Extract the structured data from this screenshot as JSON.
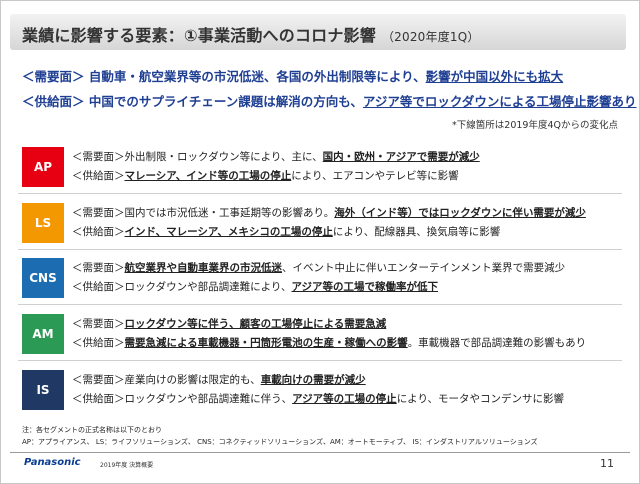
{
  "title": {
    "main": "業績に影響する要素：①事業活動へのコロナ影響",
    "sub": "（2020年度1Q）"
  },
  "summary": {
    "demand": {
      "label": "＜需要面＞",
      "text": "自動車・航空業界等の市況低迷、各国の外出制限等により、",
      "emph": "影響が中国以外にも拡大"
    },
    "supply": {
      "label": "＜供給面＞",
      "text": "中国でのサプライチェーン課題は解消の方向も、",
      "emph": "アジア等でロックダウンによる工場停止影響あり"
    }
  },
  "note_change": "*下線箇所は2019年度4Qからの変化点",
  "segments": [
    {
      "code": "AP",
      "color": "#e60012",
      "demand_prefix": "＜需要面＞外出制限・ロックダウン等により、主に、",
      "demand_emph": "国内・欧州・アジアで需要が減少",
      "demand_suffix": "",
      "supply_prefix": "＜供給面＞",
      "supply_emph": "マレーシア、インド等の工場の停止",
      "supply_suffix": "により、エアコンやテレビ等に影響"
    },
    {
      "code": "LS",
      "color": "#f39800",
      "demand_prefix": "＜需要面＞国内では市況低迷・工事延期等の影響あり。",
      "demand_emph": "海外（インド等）ではロックダウンに伴い需要が減少",
      "demand_suffix": "",
      "supply_prefix": "＜供給面＞",
      "supply_emph": "インド、マレーシア、メキシコの工場の停止",
      "supply_suffix": "により、配線器具、換気扇等に影響"
    },
    {
      "code": "CNS",
      "color": "#1b6cb0",
      "demand_prefix": "＜需要面＞",
      "demand_emph": "航空業界や自動車業界の市況低迷",
      "demand_suffix": "、イベント中止に伴いエンターテインメント業界で需要減少",
      "supply_prefix": "＜供給面＞ロックダウンや部品調達難により、",
      "supply_emph": "アジア等の工場で稼働率が低下",
      "supply_suffix": ""
    },
    {
      "code": "AM",
      "color": "#2b9a55",
      "demand_prefix": "＜需要面＞",
      "demand_emph": "ロックダウン等に伴う、顧客の工場停止による需要急減",
      "demand_suffix": "",
      "supply_prefix": "＜供給面＞",
      "supply_emph": "需要急減による車載機器・円筒形電池の生産・稼働への影響",
      "supply_suffix": "。車載機器で部品調達難の影響もあり"
    },
    {
      "code": "IS",
      "color": "#1f3864",
      "demand_prefix": "＜需要面＞産業向けの影響は限定的も、",
      "demand_emph": "車載向けの需要が減少",
      "demand_suffix": "",
      "supply_prefix": "＜供給面＞ロックダウンや部品調達難に伴う、",
      "supply_emph": "アジア等の工場の停止",
      "supply_suffix": "により、モータやコンデンサに影響"
    }
  ],
  "footnote": {
    "line1": "注：各セグメントの正式名称は以下のとおり",
    "line2": "AP：アプライアンス、 LS：ライフソリューションズ、 CNS：コネクティッドソリューションズ、AM：オートモーティブ、 IS：インダストリアルソリューションズ"
  },
  "footer": {
    "logo": "Panasonic",
    "text": "2019年度 決算概要",
    "page": "11"
  }
}
